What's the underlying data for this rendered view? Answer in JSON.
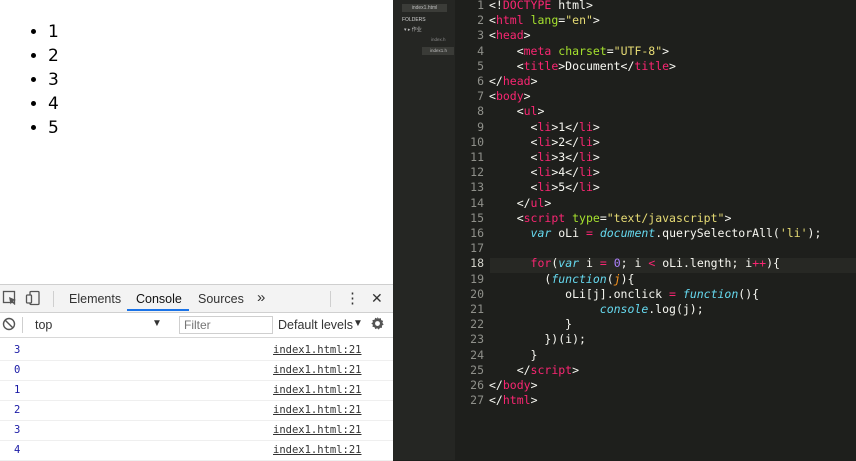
{
  "browser": {
    "list_items": [
      "1",
      "2",
      "3",
      "4",
      "5"
    ]
  },
  "devtools": {
    "tabs": [
      "Elements",
      "Console",
      "Sources"
    ],
    "active_tab": "Console",
    "more_tabs_glyph": "»",
    "menu_glyph": "⋮",
    "close_glyph": "✕",
    "context": "top",
    "filter_placeholder": "Filter",
    "log_levels": "Default levels",
    "console_rows": [
      {
        "value": "3",
        "source": "index1.html:21"
      },
      {
        "value": "0",
        "source": "index1.html:21"
      },
      {
        "value": "1",
        "source": "index1.html:21"
      },
      {
        "value": "2",
        "source": "index1.html:21"
      },
      {
        "value": "3",
        "source": "index1.html:21"
      },
      {
        "value": "4",
        "source": "index1.html:21"
      }
    ]
  },
  "editor": {
    "sidebar": {
      "open_file": "index1.html",
      "folders_label": "FOLDERS",
      "root_folder": "▾ ▸ 作业",
      "files": [
        "index.h",
        "index1.h"
      ]
    },
    "active_line": 18,
    "line_numbers": [
      "1",
      "2",
      "3",
      "4",
      "5",
      "6",
      "7",
      "8",
      "9",
      "10",
      "11",
      "12",
      "13",
      "14",
      "15",
      "16",
      "17",
      "18",
      "19",
      "20",
      "21",
      "22",
      "23",
      "24",
      "25",
      "26",
      "27"
    ],
    "code_lines": [
      [
        [
          "t-plain",
          "<!"
        ],
        [
          "t-tag",
          "DOCTYPE"
        ],
        [
          "t-plain",
          " html>"
        ]
      ],
      [
        [
          "t-plain",
          "<"
        ],
        [
          "t-tag",
          "html"
        ],
        [
          "t-plain",
          " "
        ],
        [
          "t-attr",
          "lang"
        ],
        [
          "t-plain",
          "="
        ],
        [
          "t-str",
          "\"en\""
        ],
        [
          "t-plain",
          ">"
        ]
      ],
      [
        [
          "t-plain",
          "<"
        ],
        [
          "t-tag",
          "head"
        ],
        [
          "t-plain",
          ">"
        ]
      ],
      [
        [
          "t-plain",
          "    <"
        ],
        [
          "t-tag",
          "meta"
        ],
        [
          "t-plain",
          " "
        ],
        [
          "t-attr",
          "charset"
        ],
        [
          "t-plain",
          "="
        ],
        [
          "t-str",
          "\"UTF-8\""
        ],
        [
          "t-plain",
          ">"
        ]
      ],
      [
        [
          "t-plain",
          "    <"
        ],
        [
          "t-tag",
          "title"
        ],
        [
          "t-plain",
          ">Document</"
        ],
        [
          "t-tag",
          "title"
        ],
        [
          "t-plain",
          ">"
        ]
      ],
      [
        [
          "t-plain",
          "</"
        ],
        [
          "t-tag",
          "head"
        ],
        [
          "t-plain",
          ">"
        ]
      ],
      [
        [
          "t-plain",
          "<"
        ],
        [
          "t-tag",
          "body"
        ],
        [
          "t-plain",
          ">"
        ]
      ],
      [
        [
          "t-plain",
          "    <"
        ],
        [
          "t-tag",
          "ul"
        ],
        [
          "t-plain",
          ">"
        ]
      ],
      [
        [
          "t-plain",
          "      <"
        ],
        [
          "t-tag",
          "li"
        ],
        [
          "t-plain",
          ">1</"
        ],
        [
          "t-tag",
          "li"
        ],
        [
          "t-plain",
          ">"
        ]
      ],
      [
        [
          "t-plain",
          "      <"
        ],
        [
          "t-tag",
          "li"
        ],
        [
          "t-plain",
          ">2</"
        ],
        [
          "t-tag",
          "li"
        ],
        [
          "t-plain",
          ">"
        ]
      ],
      [
        [
          "t-plain",
          "      <"
        ],
        [
          "t-tag",
          "li"
        ],
        [
          "t-plain",
          ">3</"
        ],
        [
          "t-tag",
          "li"
        ],
        [
          "t-plain",
          ">"
        ]
      ],
      [
        [
          "t-plain",
          "      <"
        ],
        [
          "t-tag",
          "li"
        ],
        [
          "t-plain",
          ">4</"
        ],
        [
          "t-tag",
          "li"
        ],
        [
          "t-plain",
          ">"
        ]
      ],
      [
        [
          "t-plain",
          "      <"
        ],
        [
          "t-tag",
          "li"
        ],
        [
          "t-plain",
          ">5</"
        ],
        [
          "t-tag",
          "li"
        ],
        [
          "t-plain",
          ">"
        ]
      ],
      [
        [
          "t-plain",
          "    </"
        ],
        [
          "t-tag",
          "ul"
        ],
        [
          "t-plain",
          ">"
        ]
      ],
      [
        [
          "t-plain",
          "    <"
        ],
        [
          "t-tag",
          "script"
        ],
        [
          "t-plain",
          " "
        ],
        [
          "t-attr",
          "type"
        ],
        [
          "t-plain",
          "="
        ],
        [
          "t-str",
          "\"text/javascript\""
        ],
        [
          "t-plain",
          ">"
        ]
      ],
      [
        [
          "t-plain",
          "      "
        ],
        [
          "t-kw",
          "var"
        ],
        [
          "t-plain",
          " oLi "
        ],
        [
          "t-op",
          "="
        ],
        [
          "t-plain",
          " "
        ],
        [
          "t-fn",
          "document"
        ],
        [
          "t-plain",
          ".querySelectorAll("
        ],
        [
          "t-str",
          "'li'"
        ],
        [
          "t-plain",
          ");"
        ]
      ],
      [
        [
          "t-plain",
          ""
        ]
      ],
      [
        [
          "t-plain",
          "      "
        ],
        [
          "t-op",
          "for"
        ],
        [
          "t-plain",
          "("
        ],
        [
          "t-kw",
          "var"
        ],
        [
          "t-plain",
          " i "
        ],
        [
          "t-op",
          "="
        ],
        [
          "t-plain",
          " "
        ],
        [
          "t-num",
          "0"
        ],
        [
          "t-plain",
          "; i "
        ],
        [
          "t-op",
          "<"
        ],
        [
          "t-plain",
          " oLi.length; i"
        ],
        [
          "t-op",
          "++"
        ],
        [
          "t-plain",
          "){"
        ]
      ],
      [
        [
          "t-plain",
          "        ("
        ],
        [
          "t-kw",
          "function"
        ],
        [
          "t-plain",
          "("
        ],
        [
          "t-param",
          "j"
        ],
        [
          "t-plain",
          "){"
        ]
      ],
      [
        [
          "t-plain",
          "           oLi[j].onclick "
        ],
        [
          "t-op",
          "="
        ],
        [
          "t-plain",
          " "
        ],
        [
          "t-kw",
          "function"
        ],
        [
          "t-plain",
          "(){"
        ]
      ],
      [
        [
          "t-plain",
          "                "
        ],
        [
          "t-fn",
          "console"
        ],
        [
          "t-plain",
          ".log(j);"
        ]
      ],
      [
        [
          "t-plain",
          "           }"
        ]
      ],
      [
        [
          "t-plain",
          "        })(i);"
        ]
      ],
      [
        [
          "t-plain",
          "      }"
        ]
      ],
      [
        [
          "t-plain",
          "    </"
        ],
        [
          "t-tag",
          "script"
        ],
        [
          "t-plain",
          ">"
        ]
      ],
      [
        [
          "t-plain",
          "</"
        ],
        [
          "t-tag",
          "body"
        ],
        [
          "t-plain",
          ">"
        ]
      ],
      [
        [
          "t-plain",
          "</"
        ],
        [
          "t-tag",
          "html"
        ],
        [
          "t-plain",
          ">"
        ]
      ]
    ]
  },
  "colors": {
    "editor_bg": "#1e1f1c",
    "tag": "#f92672",
    "attr": "#a6e22e",
    "string": "#e6db74",
    "keyword": "#66d9ef",
    "number": "#ae81ff",
    "console_value": "#1a1aa6",
    "active_tab_underline": "#1a73e8"
  }
}
